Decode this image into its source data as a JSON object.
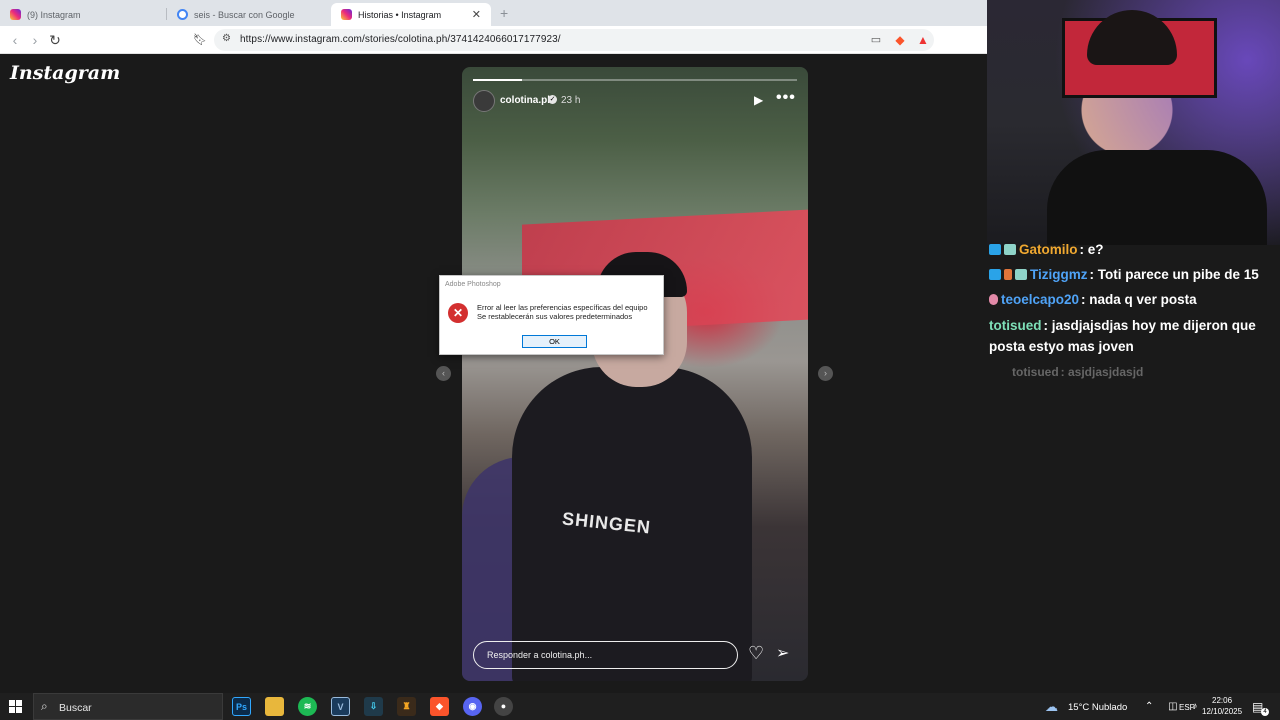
{
  "browser": {
    "tabs": [
      {
        "label": "(9) Instagram",
        "active": false
      },
      {
        "label": "seis - Buscar con Google",
        "active": false
      },
      {
        "label": "Historias • Instagram",
        "active": true
      }
    ],
    "url": "https://www.instagram.com/stories/colotina.ph/3741424066017177923/"
  },
  "instagram": {
    "logo": "Instagram",
    "story": {
      "username": "colotina.ph",
      "time": "23 h",
      "progress": 0.15,
      "shirt_text": "SHINGEN",
      "reply_placeholder": "Responder a colotina.ph..."
    }
  },
  "dialog": {
    "title": "Adobe Photoshop",
    "message_line1": "Error al leer las preferencias específicas del equipo",
    "message_line2": "Se restablecerán sus valores predeterminados",
    "ok_label": "OK"
  },
  "chat": {
    "messages": [
      {
        "user": "Gatomilo",
        "text": ": e?",
        "color": "#f0a830"
      },
      {
        "user": "Tiziggmz",
        "text": ": Toti parece un pibe de 15",
        "color": "#4fa3f7"
      },
      {
        "user": "teoelcapo20",
        "text": ": nada q ver posta",
        "color": "#4fa3f7"
      },
      {
        "user": "totisued",
        "text": ": jasdjajsdjas hoy me dijeron que",
        "color": "#7ee0b8"
      },
      {
        "user": "",
        "text": "posta estyo mas joven",
        "color": "#ffffff"
      },
      {
        "user": "totisued",
        "text": ": asjdjasjdasjd",
        "color": "#666666"
      }
    ]
  },
  "taskbar": {
    "search_label": "Buscar",
    "weather": "15°C  Nublado",
    "language": "ESP",
    "time": "22:06",
    "date": "12/10/2025",
    "notifications": "4"
  }
}
